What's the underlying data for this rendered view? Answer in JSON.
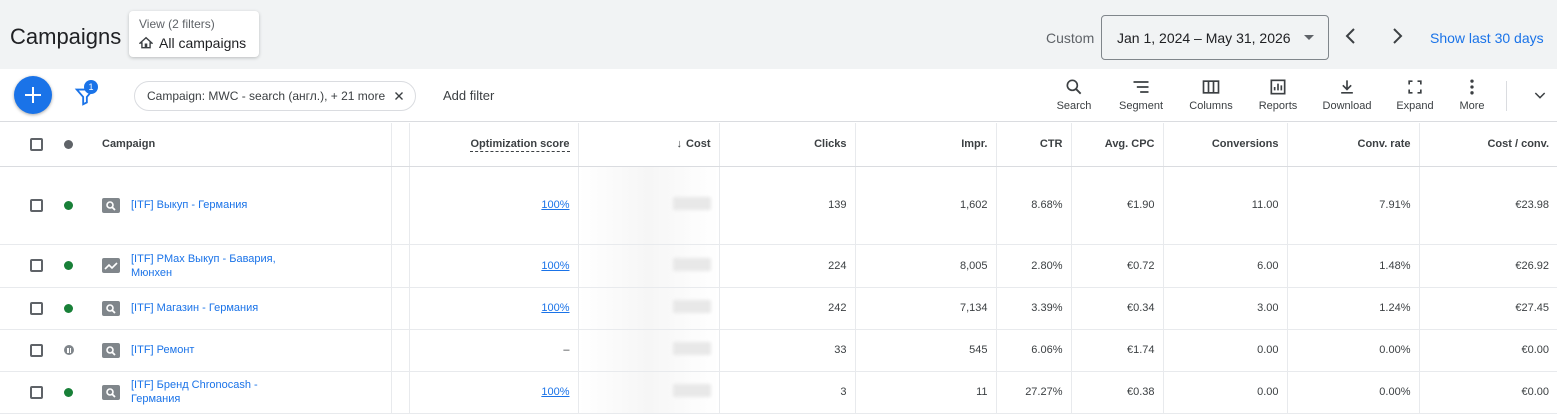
{
  "header": {
    "title": "Campaigns",
    "view_sub": "View (2 filters)",
    "view_main": "All campaigns",
    "date_label": "Custom",
    "date_range": "Jan 1, 2024 – May 31, 2026",
    "show_last": "Show last 30 days"
  },
  "toolbar": {
    "filter_count": "1",
    "chip_text": "Campaign: MWC - search (англ.), + 21 more",
    "add_filter": "Add filter",
    "tools": [
      {
        "label": "Search",
        "icon": "search-icon"
      },
      {
        "label": "Segment",
        "icon": "segment-icon"
      },
      {
        "label": "Columns",
        "icon": "columns-icon"
      },
      {
        "label": "Reports",
        "icon": "reports-icon"
      },
      {
        "label": "Download",
        "icon": "download-icon"
      },
      {
        "label": "Expand",
        "icon": "expand-icon"
      },
      {
        "label": "More",
        "icon": "more-vert-icon"
      }
    ]
  },
  "table": {
    "headers": {
      "campaign": "Campaign",
      "optimization_score": "Optimization score",
      "cost": "Cost",
      "clicks": "Clicks",
      "impr": "Impr.",
      "ctr": "CTR",
      "avg_cpc": "Avg. CPC",
      "conversions": "Conversions",
      "conv_rate": "Conv. rate",
      "cost_conv": "Cost / conv."
    },
    "rows": [
      {
        "status": "enabled",
        "type": "search",
        "name": "[ITF] Выкуп - Германия",
        "opt": "100%",
        "clicks": "139",
        "impr": "1,602",
        "ctr": "8.68%",
        "avg_cpc": "€1.90",
        "conversions": "11.00",
        "conv_rate": "7.91%",
        "cost_conv": "€23.98"
      },
      {
        "status": "enabled",
        "type": "pmax",
        "name": "[ITF] PMax Выкуп - Бавария, Мюнхен",
        "opt": "100%",
        "clicks": "224",
        "impr": "8,005",
        "ctr": "2.80%",
        "avg_cpc": "€0.72",
        "conversions": "6.00",
        "conv_rate": "1.48%",
        "cost_conv": "€26.92"
      },
      {
        "status": "enabled",
        "type": "search",
        "name": "[ITF] Магазин - Германия",
        "opt": "100%",
        "clicks": "242",
        "impr": "7,134",
        "ctr": "3.39%",
        "avg_cpc": "€0.34",
        "conversions": "3.00",
        "conv_rate": "1.24%",
        "cost_conv": "€27.45"
      },
      {
        "status": "paused",
        "type": "search",
        "name": "[ITF] Ремонт",
        "opt": "–",
        "clicks": "33",
        "impr": "545",
        "ctr": "6.06%",
        "avg_cpc": "€1.74",
        "conversions": "0.00",
        "conv_rate": "0.00%",
        "cost_conv": "€0.00"
      },
      {
        "status": "enabled",
        "type": "search",
        "name": "[ITF] Бренд Chronocash - Германия",
        "opt": "100%",
        "clicks": "3",
        "impr": "11",
        "ctr": "27.27%",
        "avg_cpc": "€0.38",
        "conversions": "0.00",
        "conv_rate": "0.00%",
        "cost_conv": "€0.00"
      }
    ]
  },
  "colors": {
    "accent": "#1a73e8",
    "enabled": "#188038",
    "paused": "#80868b"
  }
}
